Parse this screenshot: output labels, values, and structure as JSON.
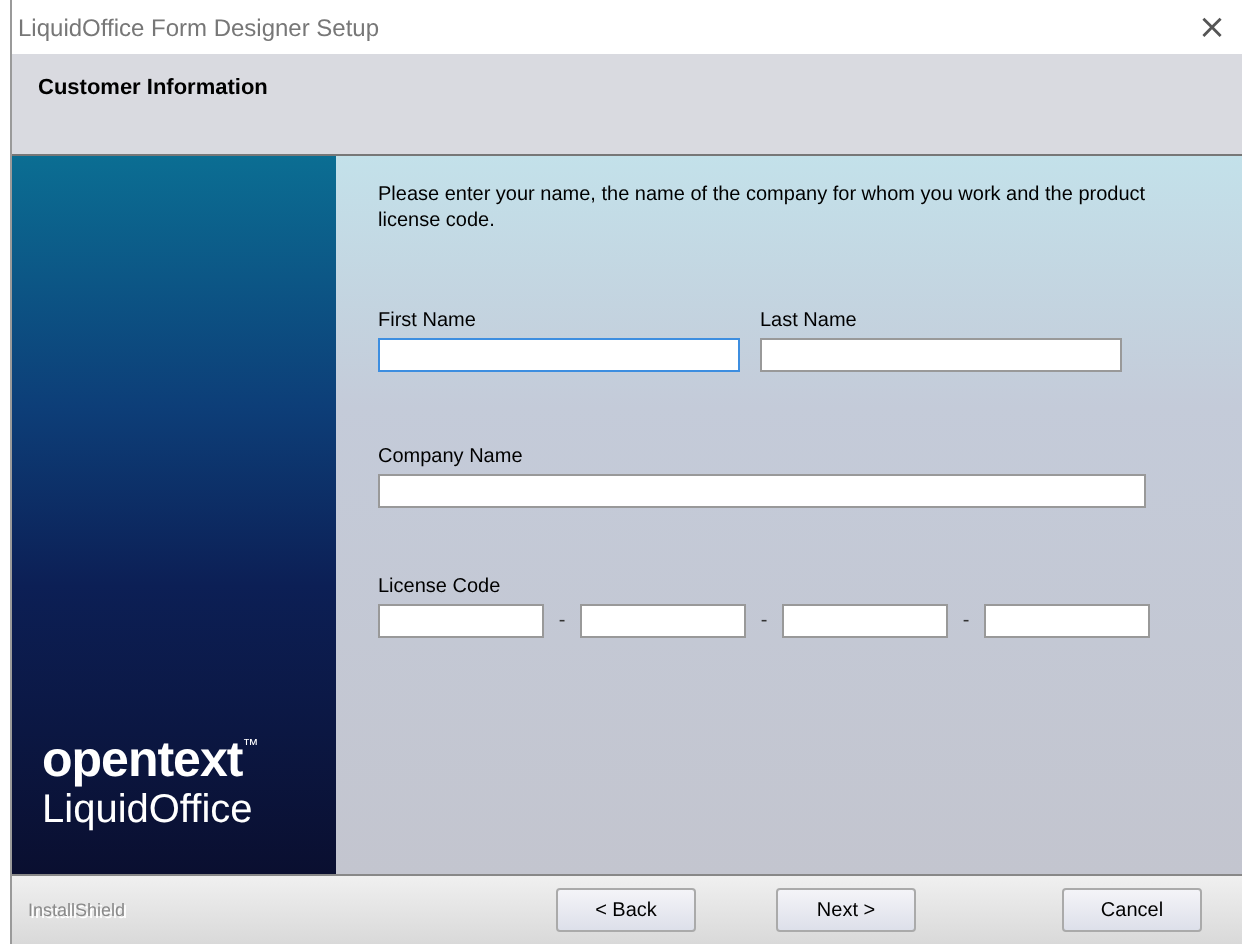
{
  "window": {
    "title": "LiquidOffice Form Designer Setup",
    "close": "×"
  },
  "header": {
    "title": "Customer Information"
  },
  "banner": {
    "brand": "opentext",
    "trademark": "™",
    "product": "LiquidOffice"
  },
  "instructions": "Please enter your name, the name of the company for whom you work and the product license code.",
  "name_fields": [
    {
      "label": "First Name",
      "focused": true
    },
    {
      "label": "Last Name",
      "focused": false
    }
  ],
  "company": {
    "label": "Company Name",
    "focused": false
  },
  "license": {
    "label": "License Code",
    "segments": [
      {
        "focused": false
      },
      {
        "focused": false
      },
      {
        "focused": false
      },
      {
        "focused": false
      }
    ],
    "separator": "-"
  },
  "footer": {
    "brand": "InstallShield",
    "buttons": [
      {
        "label": "< Back",
        "kind": "back"
      },
      {
        "label": "Next >",
        "kind": "next"
      },
      {
        "label": "Cancel",
        "kind": "cancel"
      }
    ]
  }
}
